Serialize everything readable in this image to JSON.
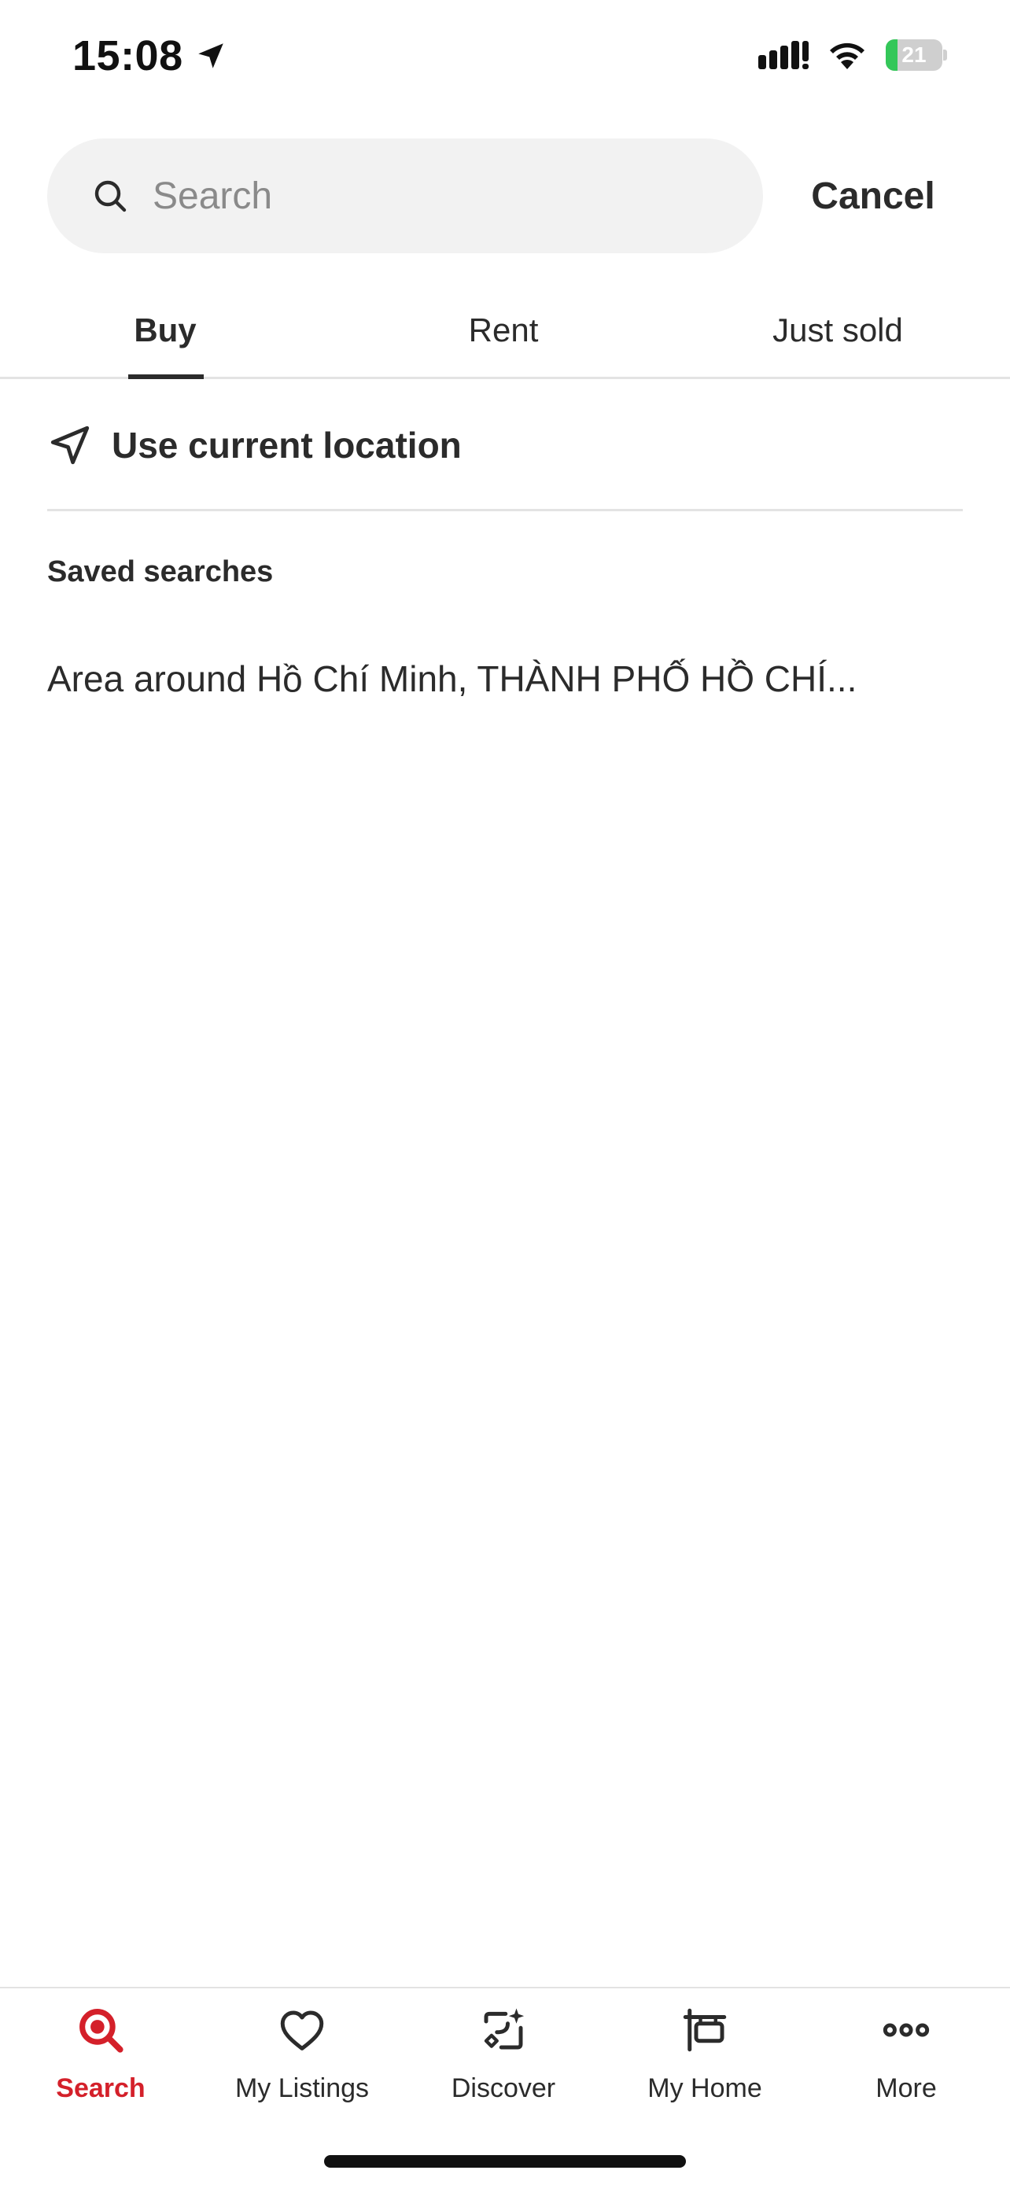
{
  "status_bar": {
    "time": "15:08",
    "battery_level": "21",
    "battery_fraction": 0.21,
    "icons": [
      "location-arrow-icon",
      "signal-icon",
      "wifi-icon",
      "battery-icon"
    ]
  },
  "search": {
    "placeholder": "Search",
    "value": "",
    "cancel_label": "Cancel"
  },
  "tabs": [
    {
      "label": "Buy",
      "active": true
    },
    {
      "label": "Rent",
      "active": false
    },
    {
      "label": "Just sold",
      "active": false
    }
  ],
  "current_location": {
    "label": "Use current location",
    "icon": "navigation-arrow-icon"
  },
  "saved_searches": {
    "title": "Saved searches",
    "items": [
      "Area around Hồ Chí Minh, THÀNH PHỐ HỒ CHÍ..."
    ]
  },
  "tab_bar": {
    "items": [
      {
        "label": "Search",
        "icon": "search-icon",
        "active": true
      },
      {
        "label": "My Listings",
        "icon": "heart-icon",
        "active": false
      },
      {
        "label": "Discover",
        "icon": "discover-icon",
        "active": false
      },
      {
        "label": "My Home",
        "icon": "house-sign-icon",
        "active": false
      },
      {
        "label": "More",
        "icon": "more-dots-icon",
        "active": false
      }
    ]
  },
  "colors": {
    "accent": "#d4202a",
    "text": "#2b2b2b",
    "search_bg": "#f2f2f2",
    "battery_fill": "#34c759"
  }
}
